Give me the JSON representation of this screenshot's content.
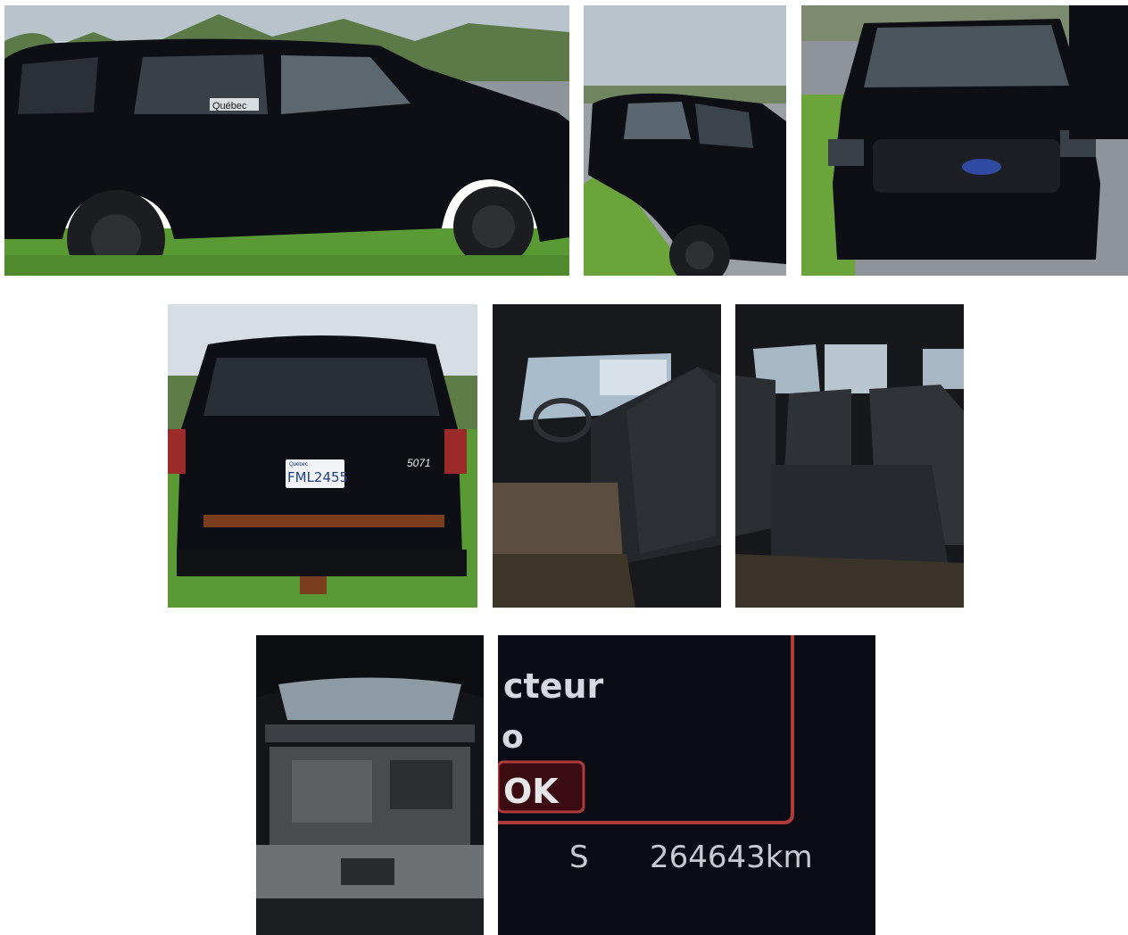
{
  "gallery": {
    "photos": [
      {
        "id": "side-left",
        "label": "Driver side view"
      },
      {
        "id": "side-angle",
        "label": "Rear quarter view"
      },
      {
        "id": "front",
        "label": "Front view"
      },
      {
        "id": "rear",
        "label": "Rear view"
      },
      {
        "id": "interior-front",
        "label": "Front interior"
      },
      {
        "id": "interior-rear",
        "label": "Rear seats"
      },
      {
        "id": "engine",
        "label": "Engine bay"
      },
      {
        "id": "odometer",
        "label": "Odometer"
      }
    ]
  },
  "door_decal": "Québec",
  "rear": {
    "plate": "FML2455",
    "plate_header": "Québec",
    "unit_number": "5071"
  },
  "odometer": {
    "word_partial": "cteur",
    "o_letter": "o",
    "ok": "OK",
    "s_letter": "S",
    "reading": "264643km"
  },
  "colors": {
    "vehicle": "#0e0f14",
    "grass": "#4f8a2f",
    "sky": "#c9d3dc",
    "display_frame": "#b13a3c"
  }
}
